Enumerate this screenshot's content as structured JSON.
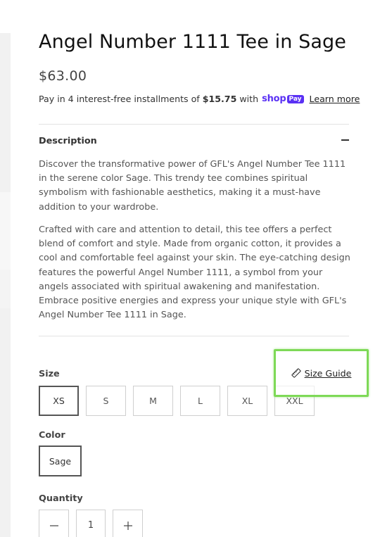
{
  "product": {
    "title": "Angel Number 1111 Tee in Sage",
    "price": "$63.00"
  },
  "installments": {
    "prefix": "Pay in 4 interest-free installments of",
    "amount": "$15.75",
    "with": "with",
    "shop_word": "shop",
    "pay_word": "Pay",
    "learn_more": "Learn more",
    "brand_color": "#5a31f4"
  },
  "description": {
    "header": "Description",
    "toggle_icon": "minus-icon",
    "paragraphs": [
      "Discover the transformative power of GFL's Angel Number Tee 1111 in the serene color Sage. This trendy tee combines spiritual symbolism with fashionable aesthetics, making it a must-have addition to your wardrobe.",
      "Crafted with care and attention to detail, this tee offers a perfect blend of comfort and style. Made from organic cotton, it provides a cool and comfortable feel against your skin. The eye-catching design features the powerful Angel Number 1111, a symbol from your angels associated with spiritual awakening and manifestation. Embrace positive energies and express your unique style with GFL's Angel Number Tee 1111 in Sage."
    ]
  },
  "size": {
    "label": "Size",
    "options": [
      "XS",
      "S",
      "M",
      "L",
      "XL",
      "XXL"
    ],
    "selected": "XS",
    "guide_label": "Size Guide",
    "guide_icon": "ruler-icon",
    "highlight_color": "#7ed957"
  },
  "color": {
    "label": "Color",
    "options": [
      "Sage"
    ],
    "selected": "Sage"
  },
  "quantity": {
    "label": "Quantity",
    "value": "1",
    "decrement_icon": "minus-icon",
    "increment_icon": "plus-icon"
  }
}
